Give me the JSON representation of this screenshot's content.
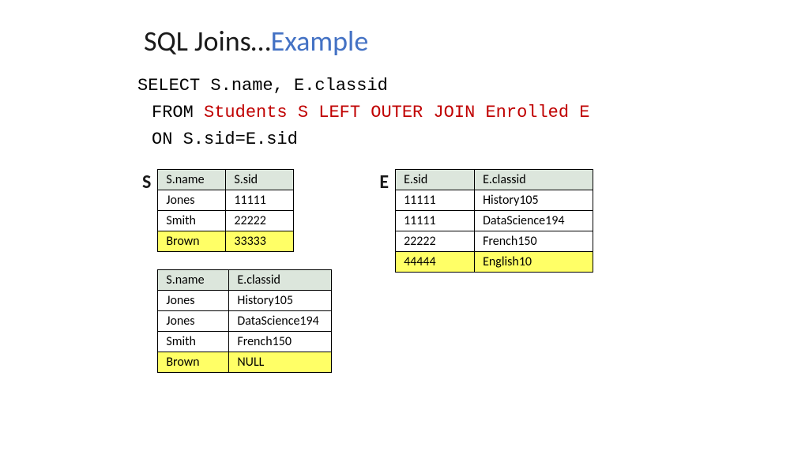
{
  "title": {
    "main": "SQL Joins…",
    "example": "Example"
  },
  "sql": {
    "line1": "SELECT S.name, E.classid",
    "line2_kw": "FROM ",
    "line2_red": "Students S LEFT OUTER JOIN Enrolled E",
    "line3_kw": "ON ",
    "line3_rest": "S.sid=E.sid"
  },
  "labels": {
    "s": "S",
    "e": "E"
  },
  "tableS": {
    "headers": [
      "S.name",
      "S.sid"
    ],
    "rows": [
      {
        "c": [
          "Jones",
          "11111"
        ],
        "hl": false
      },
      {
        "c": [
          "Smith",
          "22222"
        ],
        "hl": false
      },
      {
        "c": [
          "Brown",
          "33333"
        ],
        "hl": true
      }
    ]
  },
  "tableE": {
    "headers": [
      "E.sid",
      "E.classid"
    ],
    "rows": [
      {
        "c": [
          "11111",
          "History105"
        ],
        "hl": false
      },
      {
        "c": [
          "11111",
          "DataScience194"
        ],
        "hl": false
      },
      {
        "c": [
          "22222",
          "French150"
        ],
        "hl": false
      },
      {
        "c": [
          "44444",
          "English10"
        ],
        "hl": true
      }
    ]
  },
  "tableResult": {
    "headers": [
      "S.name",
      "E.classid"
    ],
    "rows": [
      {
        "c": [
          "Jones",
          "History105"
        ],
        "hl": false
      },
      {
        "c": [
          "Jones",
          "DataScience194"
        ],
        "hl": false
      },
      {
        "c": [
          "Smith",
          "French150"
        ],
        "hl": false
      },
      {
        "c": [
          "Brown",
          "NULL"
        ],
        "hl": true
      }
    ]
  }
}
